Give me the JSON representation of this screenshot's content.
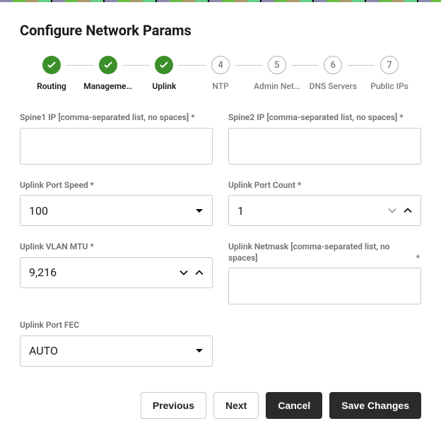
{
  "title": "Configure Network Params",
  "steps": [
    {
      "label": "Routing",
      "done": true
    },
    {
      "label": "Manageme…",
      "done": true
    },
    {
      "label": "Uplink",
      "done": true
    },
    {
      "label": "NTP",
      "num": "4",
      "done": false
    },
    {
      "label": "Admin Net…",
      "num": "5",
      "done": false
    },
    {
      "label": "DNS Servers",
      "num": "6",
      "done": false
    },
    {
      "label": "Public IPs",
      "num": "7",
      "done": false
    }
  ],
  "fields": {
    "spine1": {
      "label": "Spine1 IP [comma-separated list, no spaces]",
      "req": "*",
      "value": ""
    },
    "spine2": {
      "label": "Spine2 IP [comma-separated list, no spaces]",
      "req": "*",
      "value": ""
    },
    "portSpeed": {
      "label": "Uplink Port Speed",
      "req": "*",
      "value": "100"
    },
    "portCount": {
      "label": "Uplink Port Count",
      "req": "*",
      "value": "1"
    },
    "vlanMtu": {
      "label": "Uplink VLAN MTU",
      "req": "*",
      "value": "9,216"
    },
    "netmask": {
      "label": "Uplink Netmask [comma-separated list, no spaces]",
      "req": "*",
      "value": ""
    },
    "portFec": {
      "label": "Uplink Port FEC",
      "value": "AUTO"
    }
  },
  "buttons": {
    "prev": "Previous",
    "next": "Next",
    "cancel": "Cancel",
    "save": "Save Changes"
  }
}
